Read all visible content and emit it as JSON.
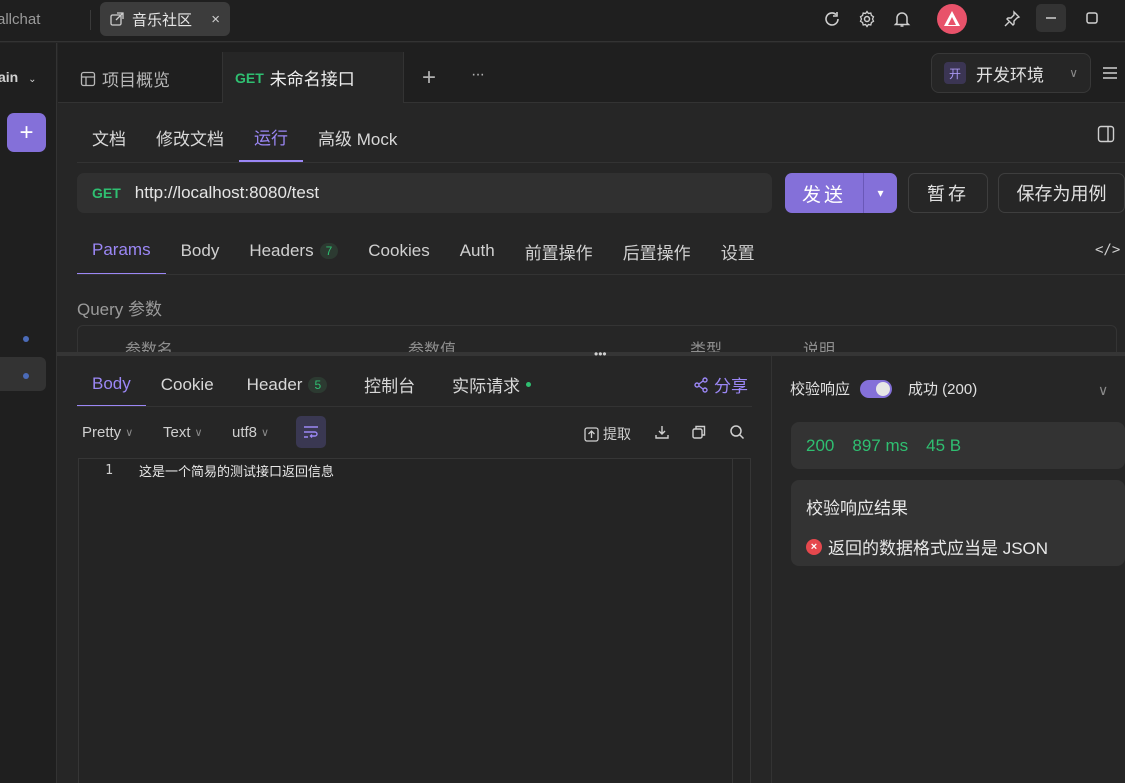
{
  "topbar": {
    "workspace": "allchat",
    "project_tab": "音乐社区",
    "close": "×"
  },
  "sidebar": {
    "branch": "ain",
    "add": "+"
  },
  "tabs": {
    "overview": "项目概览",
    "active_method": "GET",
    "active_title": "未命名接口",
    "add": "+",
    "more": "···"
  },
  "environment": {
    "badge": "开",
    "label": "开发环境"
  },
  "subnav": [
    "文档",
    "修改文档",
    "运行",
    "高级 Mock"
  ],
  "request": {
    "method": "GET",
    "url": "http://localhost:8080/test",
    "send": "发送",
    "save_temp": "暂存",
    "save_case": "保存为用例"
  },
  "request_tabs": [
    {
      "label": "Params",
      "count": ""
    },
    {
      "label": "Body",
      "count": ""
    },
    {
      "label": "Headers",
      "count": "7"
    },
    {
      "label": "Cookies",
      "count": ""
    },
    {
      "label": "Auth",
      "count": ""
    },
    {
      "label": "前置操作",
      "count": ""
    },
    {
      "label": "后置操作",
      "count": ""
    },
    {
      "label": "设置",
      "count": ""
    }
  ],
  "query": {
    "title": "Query 参数",
    "columns": [
      "参数名",
      "参数值",
      "类型",
      "说明"
    ]
  },
  "response_tabs": [
    {
      "label": "Body",
      "count": ""
    },
    {
      "label": "Cookie",
      "count": ""
    },
    {
      "label": "Header",
      "count": "5"
    },
    {
      "label": "控制台",
      "count": ""
    },
    {
      "label": "实际请求",
      "count": ""
    }
  ],
  "share": "分享",
  "format": {
    "pretty": "Pretty",
    "type": "Text",
    "encoding": "utf8",
    "extract": "提取"
  },
  "editor": {
    "line_number": "1",
    "content": "这是一个简易的测试接口返回信息"
  },
  "verify": {
    "label": "校验响应",
    "status": "成功 (200)"
  },
  "stats": {
    "code": "200",
    "time": "897 ms",
    "size": "45 B"
  },
  "result": {
    "title": "校验响应结果",
    "message": "返回的数据格式应当是 JSON"
  },
  "colors": {
    "accent": "#8470d9",
    "success": "#2fbf71",
    "error": "#e5484d"
  }
}
